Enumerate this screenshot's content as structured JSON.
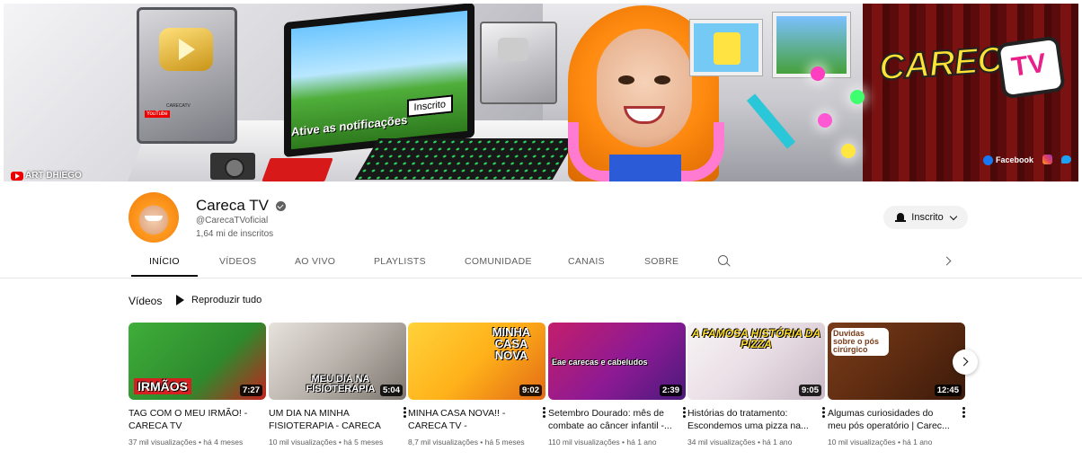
{
  "banner": {
    "monitor_text": "Ative as notificações",
    "monitor_button": "Inscrito",
    "logo_text": "CARECA",
    "logo_tv": "TV",
    "art_credit": "ART DHIEGO",
    "plaque_label": "YouTube",
    "plaque_channel": "CARECATV",
    "social_links": [
      {
        "label": "Facebook",
        "icon": "facebook-icon"
      },
      {
        "label": "",
        "icon": "instagram-icon"
      },
      {
        "label": "",
        "icon": "twitter-icon"
      }
    ]
  },
  "channel": {
    "name": "Careca TV",
    "handle": "@CarecaTVoficial",
    "subscribers": "1,64 mi de inscritos",
    "subscribe_label": "Inscrito"
  },
  "tabs": [
    {
      "label": "INÍCIO",
      "active": true
    },
    {
      "label": "VÍDEOS",
      "active": false
    },
    {
      "label": "AO VIVO",
      "active": false
    },
    {
      "label": "PLAYLISTS",
      "active": false
    },
    {
      "label": "COMUNIDADE",
      "active": false
    },
    {
      "label": "CANAIS",
      "active": false
    },
    {
      "label": "SOBRE",
      "active": false
    }
  ],
  "section": {
    "title": "Vídeos",
    "play_all": "Reproduzir tudo"
  },
  "videos": [
    {
      "title": "TAG COM O MEU IRMÃO! - CARECA TV",
      "meta": "37 mil visualizações • há 4 meses",
      "duration": "7:27",
      "overlay": "IRMÃOS"
    },
    {
      "title": "UM DIA NA MINHA FISIOTERAPIA - CARECA TV -",
      "meta": "10 mil visualizações • há 5 meses",
      "duration": "5:04",
      "overlay": "MEU DIA NA FISIOTERAPIA"
    },
    {
      "title": "MINHA CASA NOVA!! - CARECA TV -",
      "meta": "8,7 mil visualizações • há 5 meses",
      "duration": "9:02",
      "overlay": "MINHA CASA NOVA"
    },
    {
      "title": "Setembro Dourado: mês de combate ao câncer infantil -...",
      "meta": "110 mil visualizações • há 1 ano",
      "duration": "2:39",
      "overlay": "Eae carecas e cabeludos"
    },
    {
      "title": "Histórias do tratamento: Escondemos uma pizza na...",
      "meta": "34 mil visualizações • há 1 ano",
      "duration": "9:05",
      "overlay": "A FAMOSA HISTÓRIA DA PIZZA"
    },
    {
      "title": "Algumas curiosidades do meu pós operatório | Carec...",
      "meta": "10 mil visualizações • há 1 ano",
      "duration": "12:45",
      "overlay": "Duvidas sobre o pós cirúrgico"
    }
  ],
  "colors": {
    "text_primary": "#0f0f0f",
    "text_secondary": "#606060",
    "subscribe_bg": "#f2f2f2"
  }
}
